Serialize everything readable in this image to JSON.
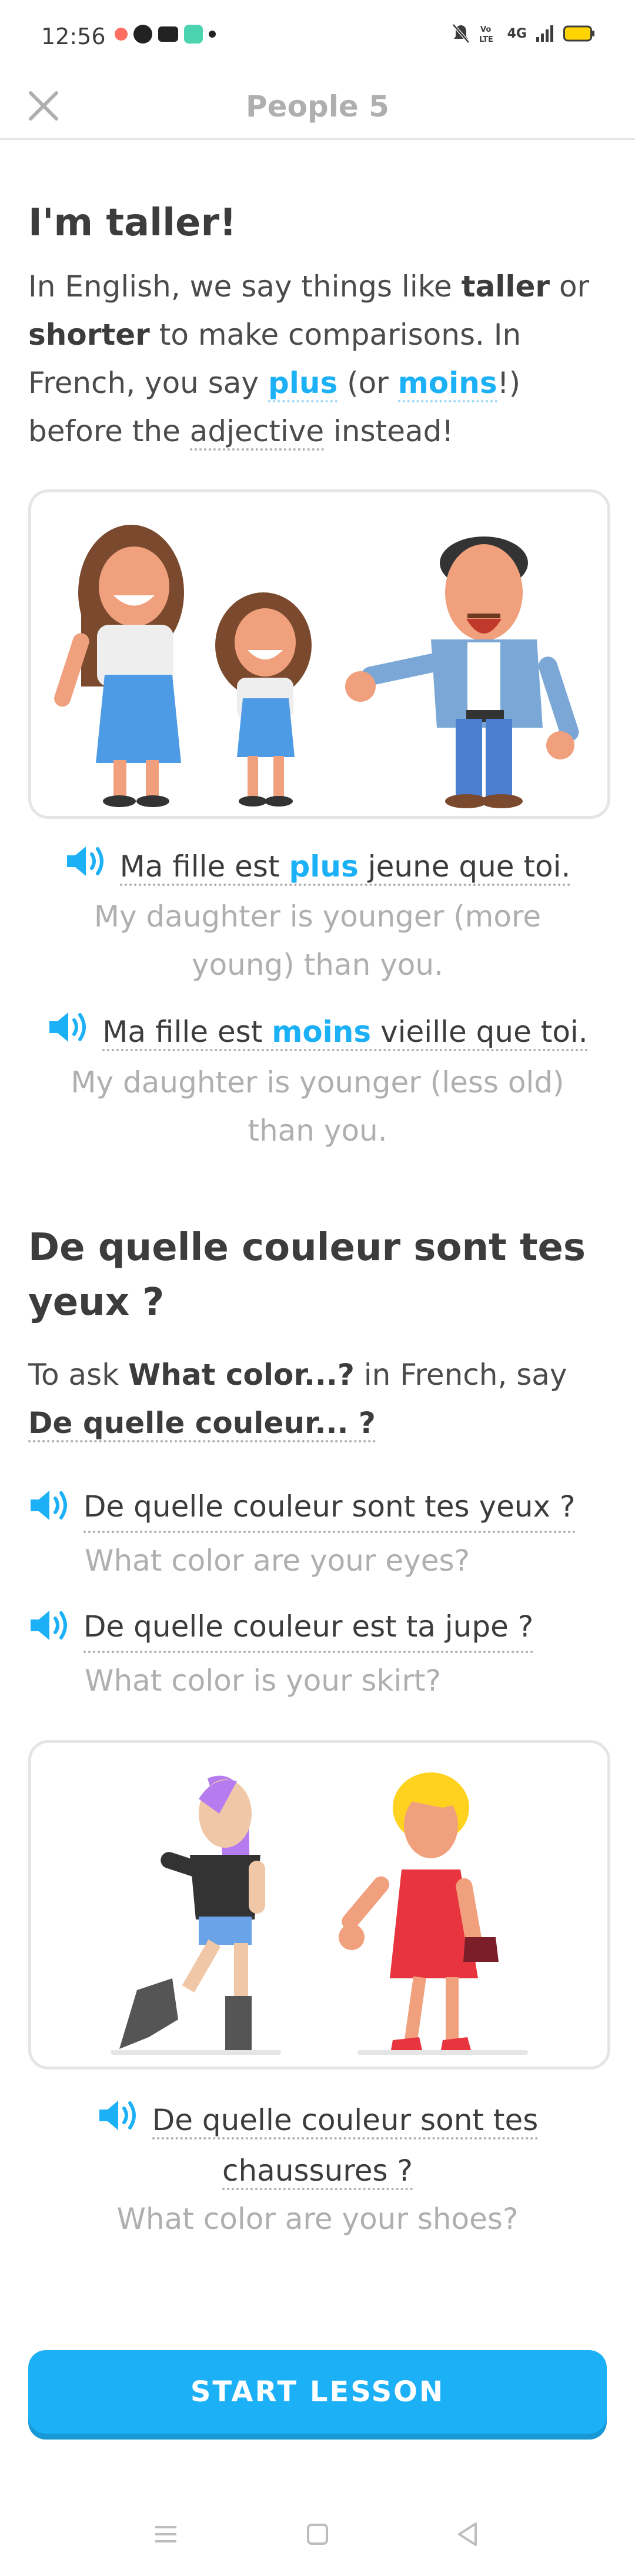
{
  "status_bar": {
    "time": "12:56",
    "right_text": "4G"
  },
  "header": {
    "title": "People 5"
  },
  "section1": {
    "title": "I'm taller!",
    "intro_parts": [
      "In English, we say things like ",
      "taller",
      " or ",
      "shorter",
      " to make comparisons. In French, you say ",
      "plus",
      " (or ",
      "moins",
      "!) before the ",
      "adjective",
      " instead!"
    ],
    "examples": [
      {
        "fr_before": "Ma fille est ",
        "fr_key": "plus",
        "fr_after": " jeune que toi.",
        "en": "My daughter is younger (more young) than you."
      },
      {
        "fr_before": "Ma fille est ",
        "fr_key": "moins",
        "fr_after": " vieille que toi.",
        "en": "My daughter is younger (less old) than you."
      }
    ]
  },
  "section2": {
    "title": "De quelle couleur sont tes yeux ?",
    "intro_parts": [
      "To ask ",
      "What color...?",
      " in French, say ",
      "De quelle couleur... ?"
    ],
    "examples": [
      {
        "fr": "De quelle couleur sont tes yeux ?",
        "en": "What color are your eyes?"
      },
      {
        "fr": "De quelle couleur est ta jupe ?",
        "en": "What color is your skirt?"
      }
    ],
    "final_example": {
      "fr": "De quelle couleur sont tes chaussures ?",
      "en": "What color are your shoes?"
    }
  },
  "start_button": "START LESSON",
  "colors": {
    "accent": "#1cb0f6",
    "accent_shadow": "#1899d6",
    "text": "#4b4b4b",
    "muted": "#afafaf",
    "border": "#e5e5e5"
  },
  "icons": [
    "close-icon",
    "speaker-icon",
    "menu-nav-icon",
    "home-nav-icon",
    "back-nav-icon"
  ]
}
